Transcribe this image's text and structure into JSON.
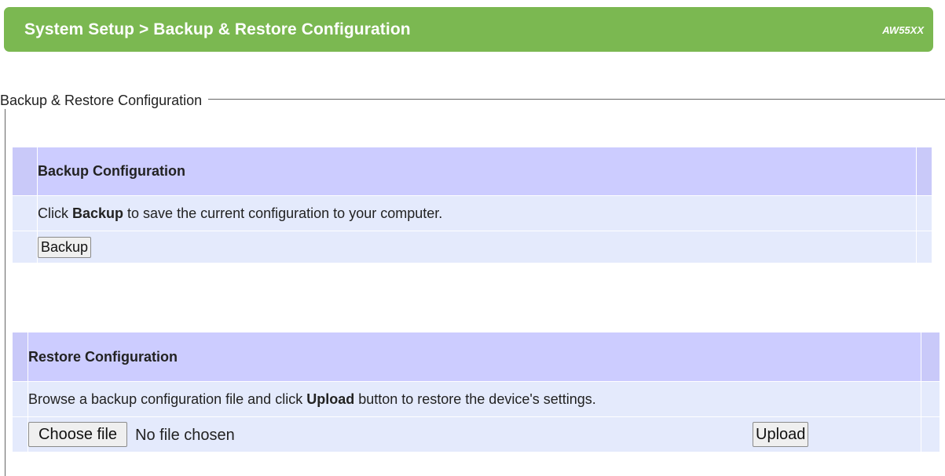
{
  "header": {
    "title": "System Setup > Backup & Restore Configuration",
    "model": "AW55XX"
  },
  "section": {
    "legend": "Backup & Restore Configuration"
  },
  "backup": {
    "title": "Backup Configuration",
    "desc_prefix": "Click ",
    "desc_bold": "Backup",
    "desc_suffix": " to save the current configuration to your computer.",
    "button_label": "Backup"
  },
  "restore": {
    "title": "Restore Configuration",
    "desc_prefix": "Browse a backup configuration file and click ",
    "desc_bold": "Upload",
    "desc_suffix": " button to restore the device's settings.",
    "choose_file_label": "Choose file",
    "file_status": "No file chosen",
    "upload_label": "Upload"
  },
  "colors": {
    "header_bg": "#7bb851",
    "table_head_bg": "#ccccff",
    "table_body_bg": "#e4eafc"
  }
}
